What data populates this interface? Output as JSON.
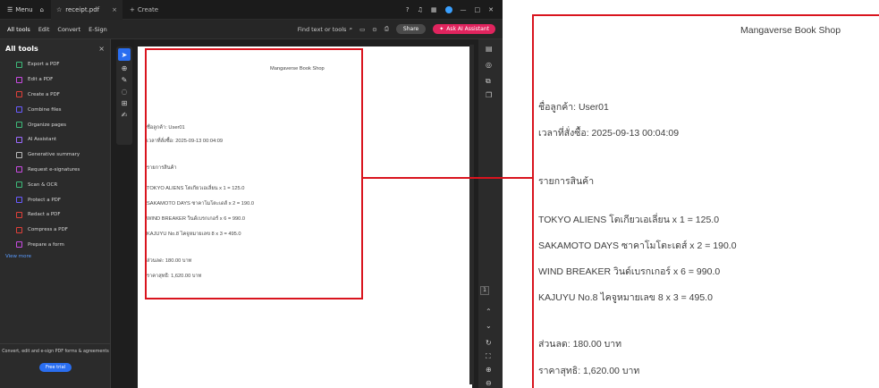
{
  "titlebar": {
    "menu_label": "Menu",
    "tab_title": "receipt.pdf",
    "tab_close": "×",
    "create_label": "Create"
  },
  "toolbar": {
    "menu": [
      "All tools",
      "Edit",
      "Convert",
      "E-Sign"
    ],
    "find_text": "Find text or tools",
    "share_label": "Share",
    "ai_label": "Ask AI Assistant"
  },
  "panel": {
    "title": "All tools",
    "close": "×",
    "tools": [
      {
        "label": "Export a PDF",
        "color": "#3dbb7a"
      },
      {
        "label": "Edit a PDF",
        "color": "#c94be3"
      },
      {
        "label": "Create a PDF",
        "color": "#e0403a"
      },
      {
        "label": "Combine files",
        "color": "#6b5bff"
      },
      {
        "label": "Organize pages",
        "color": "#3dbb7a"
      },
      {
        "label": "AI Assistant",
        "color": "#9c6bff"
      },
      {
        "label": "Generative summary",
        "color": "#bbbbbb"
      },
      {
        "label": "Request e-signatures",
        "color": "#c94be3"
      },
      {
        "label": "Scan & OCR",
        "color": "#3dbb7a"
      },
      {
        "label": "Protect a PDF",
        "color": "#6b5bff"
      },
      {
        "label": "Redact a PDF",
        "color": "#e0403a"
      },
      {
        "label": "Compress a PDF",
        "color": "#e0403a"
      },
      {
        "label": "Prepare a form",
        "color": "#c94be3"
      }
    ],
    "view_more": "View more",
    "promo": "Convert, edit and e-sign PDF forms & agreements",
    "free_trial": "Free trial"
  },
  "page_indicator": "1",
  "document": {
    "shop": "Mangaverse Book Shop",
    "customer": "ชื่อลูกค้า: User01",
    "order_time": "เวลาที่สั่งซื้อ: 2025-09-13 00:04:09",
    "items_header": "รายการสินค้า",
    "items": [
      "TOKYO ALIENS โตเกียวเอเลี่ยน x 1 = 125.0",
      "SAKAMOTO DAYS ซาคาโมโตะเดส์ x 2 = 190.0",
      "WIND BREAKER วินด์เบรกเกอร์ x 6 = 990.0",
      "KAJUYU No.8 ไคจูหมายเลข 8 x 3 = 495.0"
    ],
    "discount": "ส่วนลด: 180.00 บาท",
    "net": "ราคาสุทธิ: 1,620.00 บาท"
  }
}
